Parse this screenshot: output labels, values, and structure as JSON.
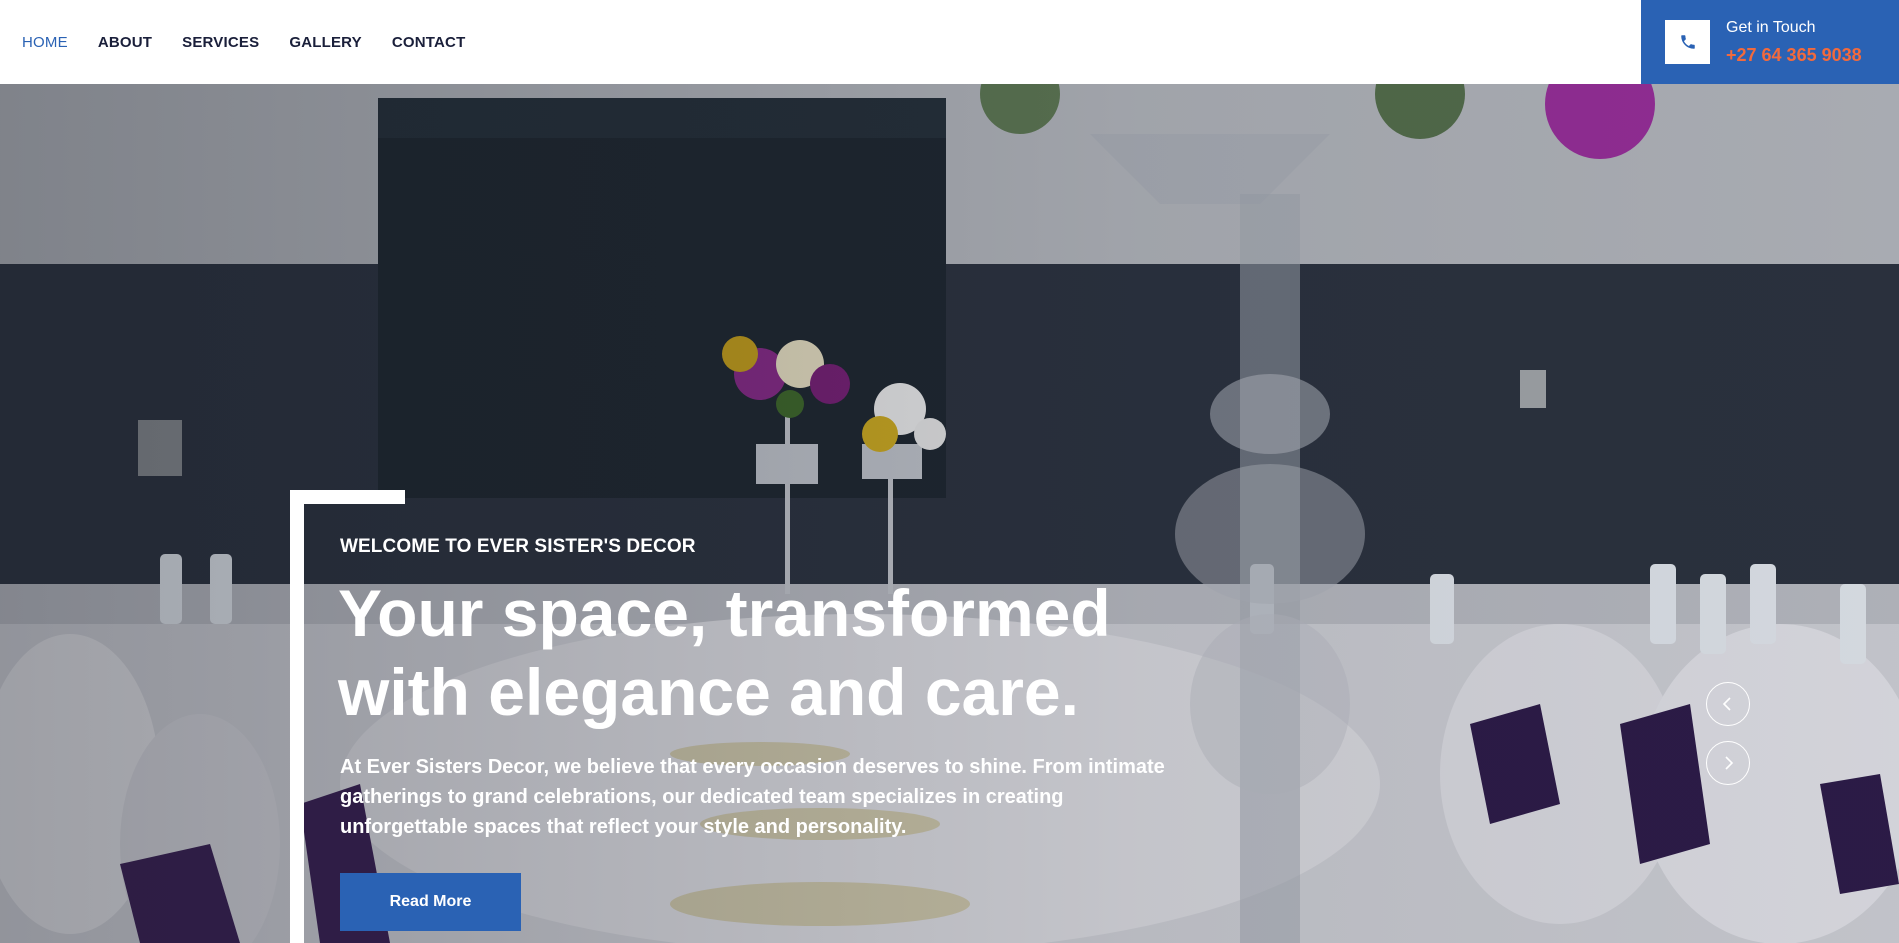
{
  "nav": {
    "items": [
      {
        "label": "HOME",
        "active": true
      },
      {
        "label": "ABOUT",
        "active": false
      },
      {
        "label": "SERVICES",
        "active": false
      },
      {
        "label": "GALLERY",
        "active": false
      },
      {
        "label": "CONTACT",
        "active": false
      }
    ]
  },
  "contact": {
    "label": "Get in Touch",
    "phone": "+27 64 365 9038",
    "icon": "phone-icon"
  },
  "hero": {
    "kicker": "WELCOME TO EVER SISTER'S DECOR",
    "headline_line1": "Your space, transformed",
    "headline_line2": "with elegance and care.",
    "description": "At Ever Sisters Decor, we believe that every occasion deserves to shine. From intimate gatherings to grand celebrations, our dedicated team specializes in creating unforgettable spaces that reflect your style and personality.",
    "button_label": "Read More",
    "prev_icon": "chevron-left-icon",
    "next_icon": "chevron-right-icon"
  },
  "colors": {
    "accent": "#2a62b4",
    "phone_text": "#f26a3d",
    "nav_text": "#1a1f3a",
    "white": "#ffffff"
  }
}
